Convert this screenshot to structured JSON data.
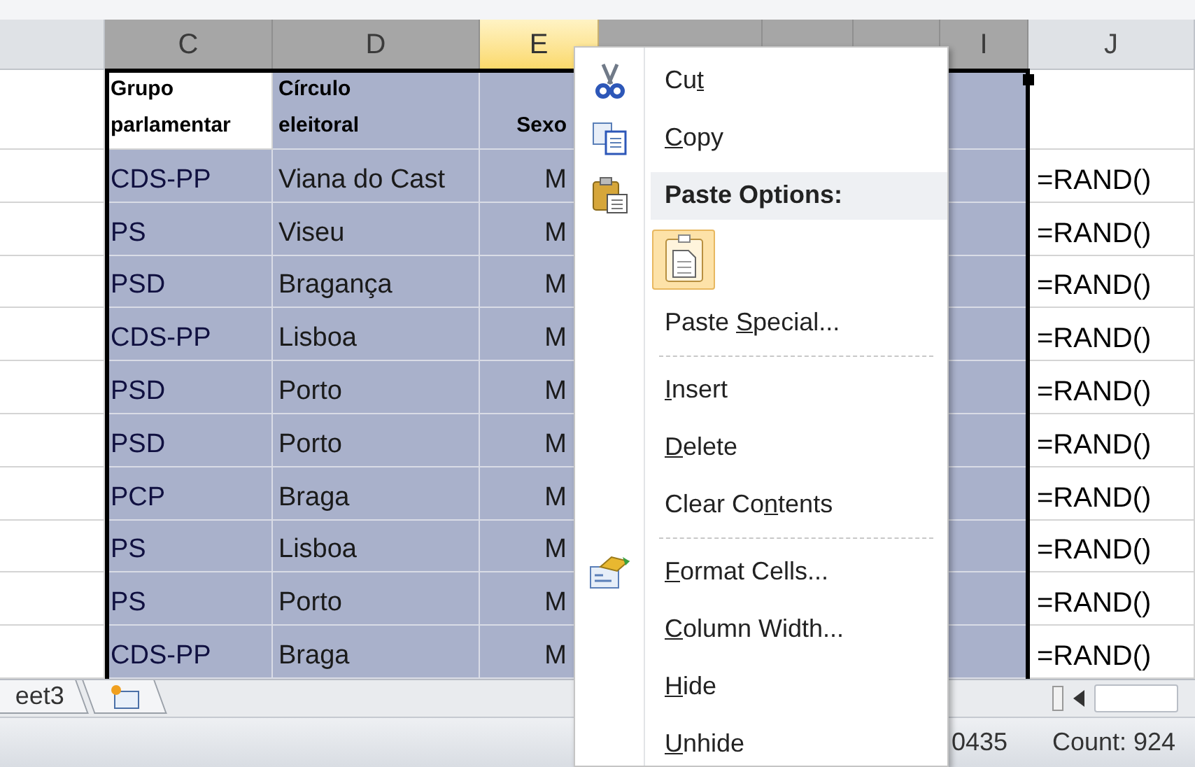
{
  "columns": [
    {
      "selected": false,
      "hover": false
    },
    {
      "letter": "C",
      "selected": true,
      "hover": false
    },
    {
      "letter": "D",
      "selected": true,
      "hover": false
    },
    {
      "letter": "E",
      "selected": true,
      "hover": true
    },
    {
      "selected": true,
      "hover": false
    },
    {
      "selected": true,
      "hover": false
    },
    {
      "selected": true,
      "hover": false
    },
    {
      "letter": "I",
      "selected": true,
      "hover": false
    },
    {
      "letter": "J",
      "selected": false,
      "hover": false
    }
  ],
  "header_row": [
    {
      "text": "Grupo parlamentar",
      "active": true
    },
    {
      "text": "Círculo eleitoral",
      "active": false
    },
    {
      "text": "Sexo",
      "active": false
    }
  ],
  "rows": [
    {
      "cells": [
        "CDS-PP",
        "Viana do Cast",
        "M"
      ],
      "formula": "=RAND()"
    },
    {
      "cells": [
        "PS",
        "Viseu",
        "M"
      ],
      "formula": "=RAND()"
    },
    {
      "cells": [
        "PSD",
        "Bragança",
        "M"
      ],
      "formula": "=RAND()"
    },
    {
      "cells": [
        "CDS-PP",
        "Lisboa",
        "M"
      ],
      "formula": "=RAND()"
    },
    {
      "cells": [
        "PSD",
        "Porto",
        "M"
      ],
      "formula": "=RAND()"
    },
    {
      "cells": [
        "PSD",
        "Porto",
        "M"
      ],
      "formula": "=RAND()"
    },
    {
      "cells": [
        "PCP",
        "Braga",
        "M"
      ],
      "formula": "=RAND()"
    },
    {
      "cells": [
        "PS",
        "Lisboa",
        "M"
      ],
      "formula": "=RAND()"
    },
    {
      "cells": [
        "PS",
        "Porto",
        "M"
      ],
      "formula": "=RAND()"
    },
    {
      "cells": [
        "CDS-PP",
        "Braga",
        "M"
      ],
      "formula": "=RAND()"
    }
  ],
  "context_menu": [
    {
      "kind": "cut",
      "before": "Cu",
      "key": "t"
    },
    {
      "kind": "copy",
      "key": "C",
      "after": "opy"
    },
    {
      "kind": "paste-header",
      "before": "Paste Options:"
    },
    {
      "kind": "paste-option",
      "hovered": true
    },
    {
      "kind": "command",
      "before": "Paste ",
      "key": "S",
      "after": "pecial..."
    },
    {
      "kind": "separator"
    },
    {
      "kind": "command",
      "key": "I",
      "after": "nsert"
    },
    {
      "kind": "command",
      "key": "D",
      "after": "elete"
    },
    {
      "kind": "command",
      "before": "Clear Co",
      "key": "n",
      "after": "tents"
    },
    {
      "kind": "separator"
    },
    {
      "kind": "format",
      "key": "F",
      "after": "ormat Cells..."
    },
    {
      "kind": "command",
      "key": "C",
      "after": "olumn Width..."
    },
    {
      "kind": "command",
      "key": "H",
      "after": "ide"
    },
    {
      "kind": "command",
      "key": "U",
      "after": "nhide"
    }
  ],
  "sheet_tabs": [
    {
      "kind": "sheet",
      "label": "eet3"
    },
    {
      "kind": "new-sheet"
    }
  ],
  "status_bar": [
    "0435",
    "Count: 924"
  ]
}
